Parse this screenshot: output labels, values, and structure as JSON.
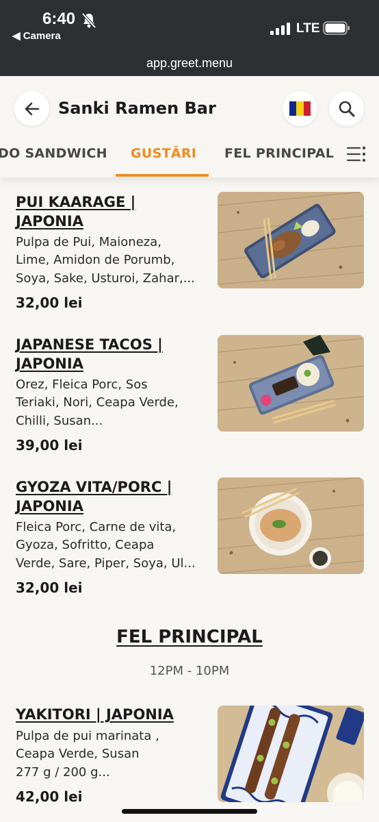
{
  "status_bar": {
    "time": "6:40",
    "back_label": "◀ Camera",
    "network": "LTE",
    "url": "app.greet.menu"
  },
  "header": {
    "title": "Sanki Ramen Bar",
    "flag_colors": [
      "#0a2a8c",
      "#f6cf1a",
      "#cf1e2b"
    ]
  },
  "tabs": [
    {
      "label": "DO SANDWICH"
    },
    {
      "label": "GUSTĂRI",
      "active": true
    },
    {
      "label": "FEL PRINCIPAL"
    }
  ],
  "accent_color": "#ee8c22",
  "items": [
    {
      "name_1": "PUI KAARAGE |",
      "name_2": "JAPONIA",
      "desc_1": "Pulpa de Pui, Maioneza,",
      "desc_2": "Lime, Amidon de Porumb,",
      "desc_3": "Soya, Sake, Usturoi, Zahar,...",
      "price": "32,00 lei"
    },
    {
      "name_1": "JAPANESE TACOS |",
      "name_2": "JAPONIA",
      "desc_1": "Orez, Fleica Porc, Sos",
      "desc_2": "Teriaki, Nori, Ceapa Verde,",
      "desc_3": "Chilli, Susan...",
      "price": "39,00 lei"
    },
    {
      "name_1": "GYOZA VITA/PORC |",
      "name_2": "JAPONIA",
      "desc_1": "Fleica Porc, Carne de vita,",
      "desc_2": "Gyoza, Sofritto, Ceapa",
      "desc_3": "Verde, Sare, Piper, Soya, Ul...",
      "price": "32,00 lei"
    },
    {
      "name_1": "YAKITORI | JAPONIA",
      "desc_1": "Pulpa de pui marinata ,",
      "desc_2": "Ceapa Verde, Susan",
      "desc_3": "277 g / 200 g...",
      "price": "42,00 lei"
    }
  ],
  "section": {
    "title": "FEL PRINCIPAL",
    "hours": "12PM - 10PM"
  }
}
